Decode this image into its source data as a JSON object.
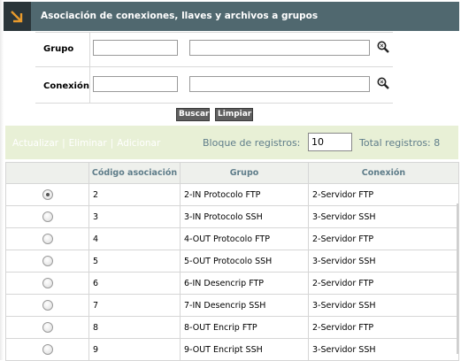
{
  "header": {
    "title": "Asociación de conexiones, llaves y archivos a grupos",
    "icon": "arrow-down-right-icon"
  },
  "search": {
    "grupo_label": "Grupo",
    "conexion_label": "Conexión",
    "grupo_code_value": "",
    "grupo_desc_value": "",
    "conexion_code_value": "",
    "conexion_desc_value": "",
    "lookup_icon": "magnifier-icon",
    "buscar_label": "Buscar",
    "limpiar_label": "Limpiar"
  },
  "toolbar": {
    "actualizar_label": "Actualizar",
    "eliminar_label": "Eliminar",
    "adicionar_label": "Adicionar",
    "separator": "|",
    "bloque_label": "Bloque de registros:",
    "bloque_value": "10",
    "total_label": "Total registros: 8"
  },
  "table": {
    "columns": [
      "",
      "Código asociación",
      "Grupo",
      "Conexión"
    ],
    "rows": [
      {
        "selected": true,
        "codigo": "2",
        "grupo": "2-IN Protocolo FTP",
        "conexion": "2-Servidor FTP"
      },
      {
        "selected": false,
        "codigo": "3",
        "grupo": "3-IN Protocolo SSH",
        "conexion": "3-Servidor SSH"
      },
      {
        "selected": false,
        "codigo": "4",
        "grupo": "4-OUT Protocolo FTP",
        "conexion": "2-Servidor FTP"
      },
      {
        "selected": false,
        "codigo": "5",
        "grupo": "5-OUT Protocolo SSH",
        "conexion": "3-Servidor SSH"
      },
      {
        "selected": false,
        "codigo": "6",
        "grupo": "6-IN Desencrip FTP",
        "conexion": "2-Servidor FTP"
      },
      {
        "selected": false,
        "codigo": "7",
        "grupo": "7-IN Desencrip SSH",
        "conexion": "3-Servidor SSH"
      },
      {
        "selected": false,
        "codigo": "8",
        "grupo": "8-OUT Encrip FTP",
        "conexion": "2-Servidor FTP"
      },
      {
        "selected": false,
        "codigo": "9",
        "grupo": "9-OUT Encript SSH",
        "conexion": "3-Servidor SSH"
      }
    ]
  },
  "colors": {
    "header_bg": "#50686f",
    "header_icon_bg": "#2a3539",
    "icon_accent": "#e89a2c",
    "toolbar_bg": "#e8f0d6",
    "label_blue_gray": "#5f7d8a"
  }
}
